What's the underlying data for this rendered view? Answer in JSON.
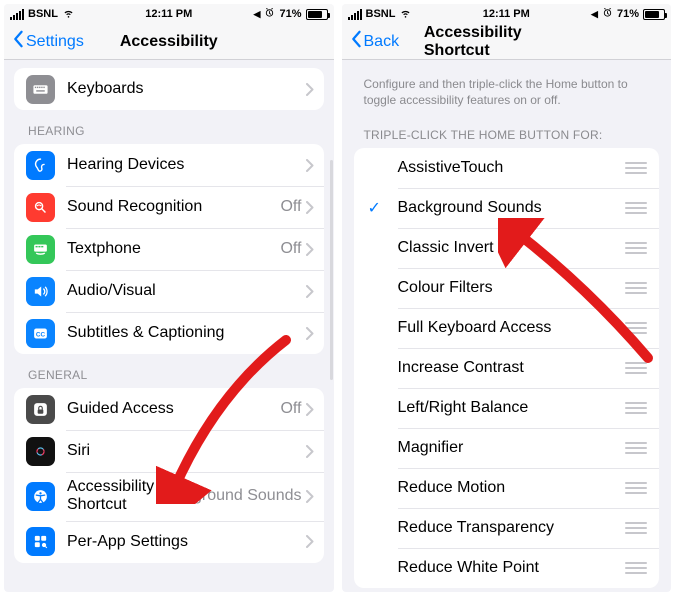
{
  "status": {
    "carrier": "BSNL",
    "time": "12:11 PM",
    "battery_pct": "71%"
  },
  "left": {
    "back": "Settings",
    "title": "Accessibility",
    "top_group": [
      {
        "icon": "keyboard-icon",
        "bg": "#8e8e93",
        "label": "Keyboards"
      }
    ],
    "hearing_label": "HEARING",
    "hearing_group": [
      {
        "icon": "ear-icon",
        "bg": "#007aff",
        "label": "Hearing Devices"
      },
      {
        "icon": "wave-icon",
        "bg": "#ff3b30",
        "label": "Sound Recognition",
        "value": "Off"
      },
      {
        "icon": "tty-icon",
        "bg": "#34c759",
        "label": "Textphone",
        "value": "Off"
      },
      {
        "icon": "speaker-icon",
        "bg": "#0a84ff",
        "label": "Audio/Visual"
      },
      {
        "icon": "cc-icon",
        "bg": "#0a84ff",
        "label": "Subtitles & Captioning"
      }
    ],
    "general_label": "GENERAL",
    "general_group": [
      {
        "icon": "lock-icon",
        "bg": "#4a4a4a",
        "label": "Guided Access",
        "value": "Off"
      },
      {
        "icon": "siri-icon",
        "bg": "#111",
        "label": "Siri"
      },
      {
        "icon": "accessibility-icon",
        "bg": "#007aff",
        "label": "Accessibility Shortcut",
        "value": "Background Sounds"
      },
      {
        "icon": "apps-icon",
        "bg": "#007aff",
        "label": "Per-App Settings"
      }
    ]
  },
  "right": {
    "back": "Back",
    "title": "Accessibility Shortcut",
    "desc": "Configure and then triple-click the Home button to toggle accessibility features on or off.",
    "section": "TRIPLE-CLICK THE HOME BUTTON FOR:",
    "options": [
      {
        "label": "AssistiveTouch",
        "checked": false
      },
      {
        "label": "Background Sounds",
        "checked": true
      },
      {
        "label": "Classic Invert",
        "checked": false
      },
      {
        "label": "Colour Filters",
        "checked": false
      },
      {
        "label": "Full Keyboard Access",
        "checked": false
      },
      {
        "label": "Increase Contrast",
        "checked": false
      },
      {
        "label": "Left/Right Balance",
        "checked": false
      },
      {
        "label": "Magnifier",
        "checked": false
      },
      {
        "label": "Reduce Motion",
        "checked": false
      },
      {
        "label": "Reduce Transparency",
        "checked": false
      },
      {
        "label": "Reduce White Point",
        "checked": false
      }
    ]
  }
}
